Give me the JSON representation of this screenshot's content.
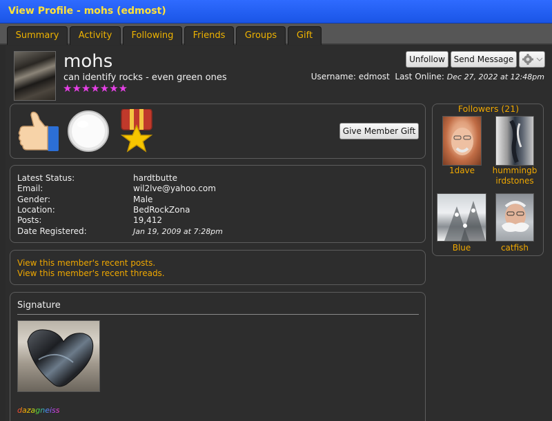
{
  "window": {
    "title": "View Profile - mohs (edmost)"
  },
  "tabs": [
    {
      "label": "Summary"
    },
    {
      "label": "Activity"
    },
    {
      "label": "Following"
    },
    {
      "label": "Friends"
    },
    {
      "label": "Groups"
    },
    {
      "label": "Gift"
    }
  ],
  "profile": {
    "display_name": "mohs",
    "tagline": "can identify rocks - even green ones",
    "stars": "★★★★★★★",
    "username_label": "Username:",
    "username": "edmost",
    "last_online_label": "Last Online:",
    "last_online": "Dec 27, 2022 at 12:48pm"
  },
  "actions": {
    "unfollow": "Unfollow",
    "send_message": "Send Message",
    "give_gift": "Give Member Gift"
  },
  "details": {
    "latest_status_label": "Latest Status:",
    "latest_status": "hardtbutte",
    "email_label": "Email:",
    "email": "wil2lve@yahoo.com",
    "gender_label": "Gender:",
    "gender": "Male",
    "location_label": "Location:",
    "location": "BedRockZona",
    "posts_label": "Posts:",
    "posts": "19,412",
    "registered_label": "Date Registered:",
    "registered": "Jan 19, 2009 at 7:28pm"
  },
  "links": {
    "recent_posts": "View this member's recent posts.",
    "recent_threads": "View this member's recent threads."
  },
  "signature": {
    "title": "Signature",
    "signature_text": "dazagneiss"
  },
  "followers": {
    "title": "Followers (21)",
    "items": [
      {
        "name": "1dave"
      },
      {
        "name": "hummingb"
      },
      {
        "name": "irdstones"
      },
      {
        "name": "Blue"
      },
      {
        "name": "catfish"
      }
    ]
  },
  "colors": {
    "accent": "#f0a800",
    "titlebar": "#2f6bff",
    "stars": "#e640e6"
  }
}
